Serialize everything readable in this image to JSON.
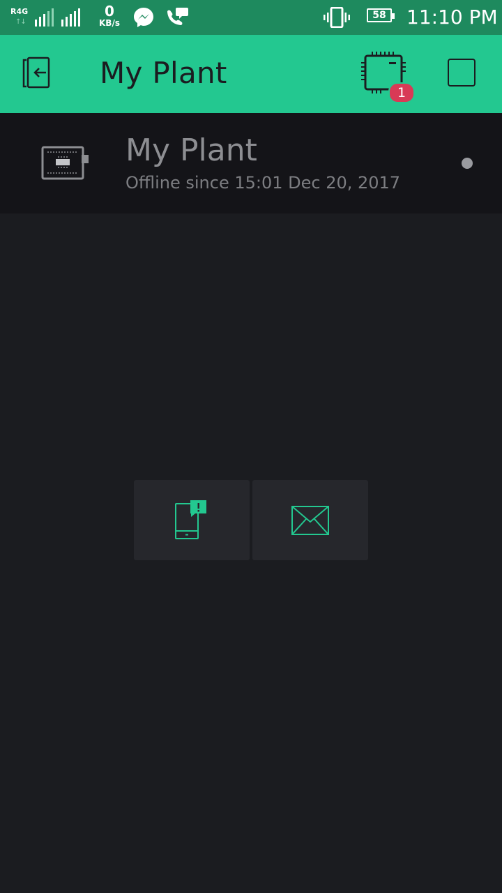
{
  "status_bar": {
    "network_type": "R4G",
    "network_arrows": "↑↓",
    "data_speed_value": "0",
    "data_speed_unit": "KB/s",
    "battery_level": "58",
    "time": "11:10 PM",
    "icons": [
      "signal-icon",
      "messenger-icon",
      "phone-chat-icon",
      "vibrate-icon",
      "battery-icon"
    ]
  },
  "app_bar": {
    "title": "My Plant",
    "device_badge_count": "1",
    "icons": [
      "back-icon",
      "device-chip-icon",
      "square-icon"
    ]
  },
  "device": {
    "name": "My Plant",
    "status": "Offline since 15:01 Dec 20, 2017",
    "icon": "board-icon"
  },
  "widgets": [
    {
      "name": "notification-widget",
      "icon": "phone-alert-icon"
    },
    {
      "name": "email-widget",
      "icon": "envelope-icon"
    }
  ],
  "colors": {
    "status_bar": "#1e8a5e",
    "accent": "#23c890",
    "background": "#1b1c20",
    "device_row": "#141418",
    "tile": "#26272c",
    "badge": "#d83a56",
    "text_muted": "#8d8e92"
  }
}
